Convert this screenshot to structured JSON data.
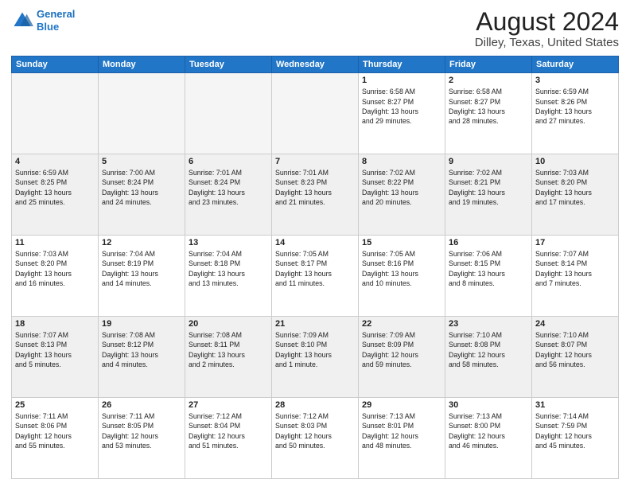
{
  "logo": {
    "line1": "General",
    "line2": "Blue"
  },
  "title": "August 2024",
  "subtitle": "Dilley, Texas, United States",
  "days_of_week": [
    "Sunday",
    "Monday",
    "Tuesday",
    "Wednesday",
    "Thursday",
    "Friday",
    "Saturday"
  ],
  "weeks": [
    [
      {
        "day": "",
        "info": "",
        "empty": true
      },
      {
        "day": "",
        "info": "",
        "empty": true
      },
      {
        "day": "",
        "info": "",
        "empty": true
      },
      {
        "day": "",
        "info": "",
        "empty": true
      },
      {
        "day": "1",
        "info": "Sunrise: 6:58 AM\nSunset: 8:27 PM\nDaylight: 13 hours\nand 29 minutes."
      },
      {
        "day": "2",
        "info": "Sunrise: 6:58 AM\nSunset: 8:27 PM\nDaylight: 13 hours\nand 28 minutes."
      },
      {
        "day": "3",
        "info": "Sunrise: 6:59 AM\nSunset: 8:26 PM\nDaylight: 13 hours\nand 27 minutes."
      }
    ],
    [
      {
        "day": "4",
        "info": "Sunrise: 6:59 AM\nSunset: 8:25 PM\nDaylight: 13 hours\nand 25 minutes."
      },
      {
        "day": "5",
        "info": "Sunrise: 7:00 AM\nSunset: 8:24 PM\nDaylight: 13 hours\nand 24 minutes."
      },
      {
        "day": "6",
        "info": "Sunrise: 7:01 AM\nSunset: 8:24 PM\nDaylight: 13 hours\nand 23 minutes."
      },
      {
        "day": "7",
        "info": "Sunrise: 7:01 AM\nSunset: 8:23 PM\nDaylight: 13 hours\nand 21 minutes."
      },
      {
        "day": "8",
        "info": "Sunrise: 7:02 AM\nSunset: 8:22 PM\nDaylight: 13 hours\nand 20 minutes."
      },
      {
        "day": "9",
        "info": "Sunrise: 7:02 AM\nSunset: 8:21 PM\nDaylight: 13 hours\nand 19 minutes."
      },
      {
        "day": "10",
        "info": "Sunrise: 7:03 AM\nSunset: 8:20 PM\nDaylight: 13 hours\nand 17 minutes."
      }
    ],
    [
      {
        "day": "11",
        "info": "Sunrise: 7:03 AM\nSunset: 8:20 PM\nDaylight: 13 hours\nand 16 minutes."
      },
      {
        "day": "12",
        "info": "Sunrise: 7:04 AM\nSunset: 8:19 PM\nDaylight: 13 hours\nand 14 minutes."
      },
      {
        "day": "13",
        "info": "Sunrise: 7:04 AM\nSunset: 8:18 PM\nDaylight: 13 hours\nand 13 minutes."
      },
      {
        "day": "14",
        "info": "Sunrise: 7:05 AM\nSunset: 8:17 PM\nDaylight: 13 hours\nand 11 minutes."
      },
      {
        "day": "15",
        "info": "Sunrise: 7:05 AM\nSunset: 8:16 PM\nDaylight: 13 hours\nand 10 minutes."
      },
      {
        "day": "16",
        "info": "Sunrise: 7:06 AM\nSunset: 8:15 PM\nDaylight: 13 hours\nand 8 minutes."
      },
      {
        "day": "17",
        "info": "Sunrise: 7:07 AM\nSunset: 8:14 PM\nDaylight: 13 hours\nand 7 minutes."
      }
    ],
    [
      {
        "day": "18",
        "info": "Sunrise: 7:07 AM\nSunset: 8:13 PM\nDaylight: 13 hours\nand 5 minutes."
      },
      {
        "day": "19",
        "info": "Sunrise: 7:08 AM\nSunset: 8:12 PM\nDaylight: 13 hours\nand 4 minutes."
      },
      {
        "day": "20",
        "info": "Sunrise: 7:08 AM\nSunset: 8:11 PM\nDaylight: 13 hours\nand 2 minutes."
      },
      {
        "day": "21",
        "info": "Sunrise: 7:09 AM\nSunset: 8:10 PM\nDaylight: 13 hours\nand 1 minute."
      },
      {
        "day": "22",
        "info": "Sunrise: 7:09 AM\nSunset: 8:09 PM\nDaylight: 12 hours\nand 59 minutes."
      },
      {
        "day": "23",
        "info": "Sunrise: 7:10 AM\nSunset: 8:08 PM\nDaylight: 12 hours\nand 58 minutes."
      },
      {
        "day": "24",
        "info": "Sunrise: 7:10 AM\nSunset: 8:07 PM\nDaylight: 12 hours\nand 56 minutes."
      }
    ],
    [
      {
        "day": "25",
        "info": "Sunrise: 7:11 AM\nSunset: 8:06 PM\nDaylight: 12 hours\nand 55 minutes."
      },
      {
        "day": "26",
        "info": "Sunrise: 7:11 AM\nSunset: 8:05 PM\nDaylight: 12 hours\nand 53 minutes."
      },
      {
        "day": "27",
        "info": "Sunrise: 7:12 AM\nSunset: 8:04 PM\nDaylight: 12 hours\nand 51 minutes."
      },
      {
        "day": "28",
        "info": "Sunrise: 7:12 AM\nSunset: 8:03 PM\nDaylight: 12 hours\nand 50 minutes."
      },
      {
        "day": "29",
        "info": "Sunrise: 7:13 AM\nSunset: 8:01 PM\nDaylight: 12 hours\nand 48 minutes."
      },
      {
        "day": "30",
        "info": "Sunrise: 7:13 AM\nSunset: 8:00 PM\nDaylight: 12 hours\nand 46 minutes."
      },
      {
        "day": "31",
        "info": "Sunrise: 7:14 AM\nSunset: 7:59 PM\nDaylight: 12 hours\nand 45 minutes."
      }
    ]
  ]
}
